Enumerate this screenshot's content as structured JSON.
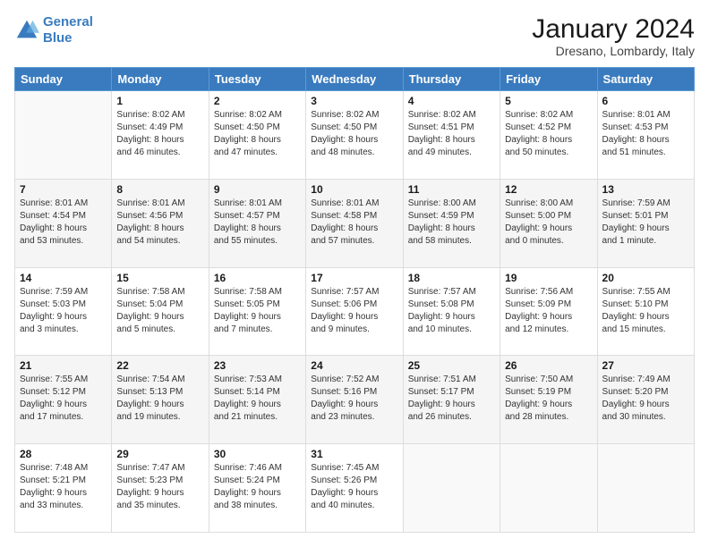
{
  "logo": {
    "line1": "General",
    "line2": "Blue"
  },
  "title": "January 2024",
  "subtitle": "Dresano, Lombardy, Italy",
  "days_header": [
    "Sunday",
    "Monday",
    "Tuesday",
    "Wednesday",
    "Thursday",
    "Friday",
    "Saturday"
  ],
  "weeks": [
    [
      {
        "day": "",
        "info": ""
      },
      {
        "day": "1",
        "info": "Sunrise: 8:02 AM\nSunset: 4:49 PM\nDaylight: 8 hours\nand 46 minutes."
      },
      {
        "day": "2",
        "info": "Sunrise: 8:02 AM\nSunset: 4:50 PM\nDaylight: 8 hours\nand 47 minutes."
      },
      {
        "day": "3",
        "info": "Sunrise: 8:02 AM\nSunset: 4:50 PM\nDaylight: 8 hours\nand 48 minutes."
      },
      {
        "day": "4",
        "info": "Sunrise: 8:02 AM\nSunset: 4:51 PM\nDaylight: 8 hours\nand 49 minutes."
      },
      {
        "day": "5",
        "info": "Sunrise: 8:02 AM\nSunset: 4:52 PM\nDaylight: 8 hours\nand 50 minutes."
      },
      {
        "day": "6",
        "info": "Sunrise: 8:01 AM\nSunset: 4:53 PM\nDaylight: 8 hours\nand 51 minutes."
      }
    ],
    [
      {
        "day": "7",
        "info": "Sunrise: 8:01 AM\nSunset: 4:54 PM\nDaylight: 8 hours\nand 53 minutes."
      },
      {
        "day": "8",
        "info": "Sunrise: 8:01 AM\nSunset: 4:56 PM\nDaylight: 8 hours\nand 54 minutes."
      },
      {
        "day": "9",
        "info": "Sunrise: 8:01 AM\nSunset: 4:57 PM\nDaylight: 8 hours\nand 55 minutes."
      },
      {
        "day": "10",
        "info": "Sunrise: 8:01 AM\nSunset: 4:58 PM\nDaylight: 8 hours\nand 57 minutes."
      },
      {
        "day": "11",
        "info": "Sunrise: 8:00 AM\nSunset: 4:59 PM\nDaylight: 8 hours\nand 58 minutes."
      },
      {
        "day": "12",
        "info": "Sunrise: 8:00 AM\nSunset: 5:00 PM\nDaylight: 9 hours\nand 0 minutes."
      },
      {
        "day": "13",
        "info": "Sunrise: 7:59 AM\nSunset: 5:01 PM\nDaylight: 9 hours\nand 1 minute."
      }
    ],
    [
      {
        "day": "14",
        "info": "Sunrise: 7:59 AM\nSunset: 5:03 PM\nDaylight: 9 hours\nand 3 minutes."
      },
      {
        "day": "15",
        "info": "Sunrise: 7:58 AM\nSunset: 5:04 PM\nDaylight: 9 hours\nand 5 minutes."
      },
      {
        "day": "16",
        "info": "Sunrise: 7:58 AM\nSunset: 5:05 PM\nDaylight: 9 hours\nand 7 minutes."
      },
      {
        "day": "17",
        "info": "Sunrise: 7:57 AM\nSunset: 5:06 PM\nDaylight: 9 hours\nand 9 minutes."
      },
      {
        "day": "18",
        "info": "Sunrise: 7:57 AM\nSunset: 5:08 PM\nDaylight: 9 hours\nand 10 minutes."
      },
      {
        "day": "19",
        "info": "Sunrise: 7:56 AM\nSunset: 5:09 PM\nDaylight: 9 hours\nand 12 minutes."
      },
      {
        "day": "20",
        "info": "Sunrise: 7:55 AM\nSunset: 5:10 PM\nDaylight: 9 hours\nand 15 minutes."
      }
    ],
    [
      {
        "day": "21",
        "info": "Sunrise: 7:55 AM\nSunset: 5:12 PM\nDaylight: 9 hours\nand 17 minutes."
      },
      {
        "day": "22",
        "info": "Sunrise: 7:54 AM\nSunset: 5:13 PM\nDaylight: 9 hours\nand 19 minutes."
      },
      {
        "day": "23",
        "info": "Sunrise: 7:53 AM\nSunset: 5:14 PM\nDaylight: 9 hours\nand 21 minutes."
      },
      {
        "day": "24",
        "info": "Sunrise: 7:52 AM\nSunset: 5:16 PM\nDaylight: 9 hours\nand 23 minutes."
      },
      {
        "day": "25",
        "info": "Sunrise: 7:51 AM\nSunset: 5:17 PM\nDaylight: 9 hours\nand 26 minutes."
      },
      {
        "day": "26",
        "info": "Sunrise: 7:50 AM\nSunset: 5:19 PM\nDaylight: 9 hours\nand 28 minutes."
      },
      {
        "day": "27",
        "info": "Sunrise: 7:49 AM\nSunset: 5:20 PM\nDaylight: 9 hours\nand 30 minutes."
      }
    ],
    [
      {
        "day": "28",
        "info": "Sunrise: 7:48 AM\nSunset: 5:21 PM\nDaylight: 9 hours\nand 33 minutes."
      },
      {
        "day": "29",
        "info": "Sunrise: 7:47 AM\nSunset: 5:23 PM\nDaylight: 9 hours\nand 35 minutes."
      },
      {
        "day": "30",
        "info": "Sunrise: 7:46 AM\nSunset: 5:24 PM\nDaylight: 9 hours\nand 38 minutes."
      },
      {
        "day": "31",
        "info": "Sunrise: 7:45 AM\nSunset: 5:26 PM\nDaylight: 9 hours\nand 40 minutes."
      },
      {
        "day": "",
        "info": ""
      },
      {
        "day": "",
        "info": ""
      },
      {
        "day": "",
        "info": ""
      }
    ]
  ]
}
